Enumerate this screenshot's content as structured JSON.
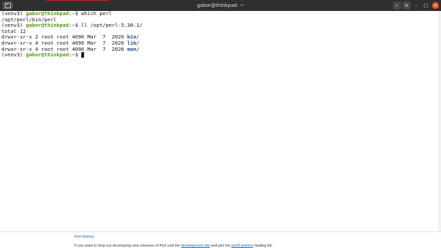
{
  "window": {
    "title": "gabor@thinkpad: ~",
    "buttons": {
      "search_icon": "⌕",
      "menu_icon": "≡",
      "minimize_icon": "–",
      "maximize_icon": "□",
      "close_icon": "×"
    }
  },
  "terminal": {
    "lines": [
      {
        "venv": "(venv3) ",
        "user": "gabor@thinkpad",
        "sep": ":",
        "path": "~",
        "dollar": "$ ",
        "cmd": "which perl"
      },
      {
        "text": "/opt/perl/bin/perl"
      },
      {
        "venv": "(venv3) ",
        "user": "gabor@thinkpad",
        "sep": ":",
        "path": "~",
        "dollar": "$ ",
        "cmd": "ll /opt/perl-5.30.1/"
      },
      {
        "text": "total 12"
      },
      {
        "meta": "drwxr-xr-x 2 root root 4096 Mar  7  2020 ",
        "name": "bin",
        "slash": "/"
      },
      {
        "meta": "drwxr-xr-x 4 root root 4096 Mar  7  2020 ",
        "name": "lib",
        "slash": "/"
      },
      {
        "meta": "drwxr-xr-x 4 root root 4096 Mar  7  2020 ",
        "name": "man",
        "slash": "/"
      },
      {
        "venv": "(venv3) ",
        "user": "gabor@thinkpad",
        "sep": ":",
        "path": "~",
        "dollar": "$ ",
        "cmd": ""
      }
    ]
  },
  "background_page": {
    "perl_history_link": "Perl History",
    "help_text_1": "If you want to help out developing new releases of Perl visit the ",
    "development_site_link": "development site",
    "help_text_2": " and join the ",
    "perl5_porters_link": "perl5-porters",
    "help_text_3": " mailing list."
  }
}
